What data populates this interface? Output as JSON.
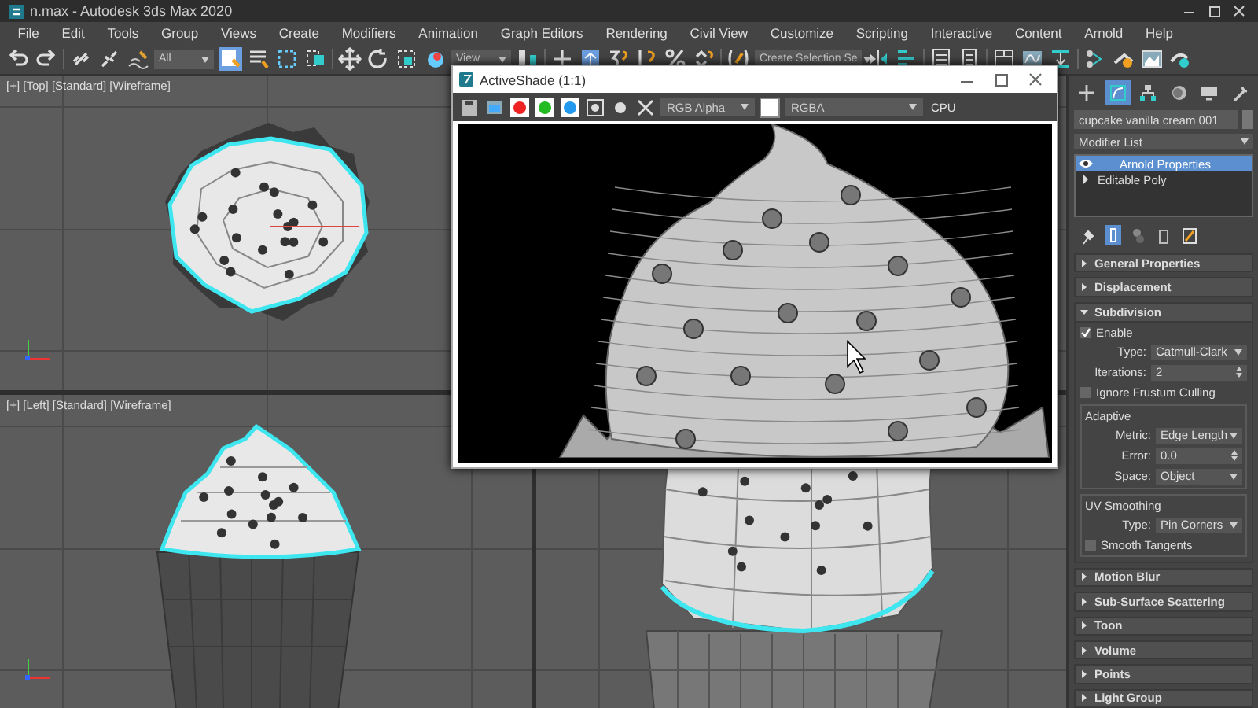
{
  "window": {
    "title": "n.max - Autodesk 3ds Max 2020"
  },
  "menu": [
    "File",
    "Edit",
    "Tools",
    "Group",
    "Views",
    "Create",
    "Modifiers",
    "Animation",
    "Graph Editors",
    "Rendering",
    "Civil View",
    "Customize",
    "Scripting",
    "Interactive",
    "Content",
    "Arnold",
    "Help"
  ],
  "toolbar": {
    "selection_filter": "All",
    "reference_coordinates": "View",
    "selection_set": "Create Selection Se"
  },
  "viewports": [
    {
      "label": "[+] [Top] [Standard] [Wireframe]",
      "kind": "top"
    },
    {
      "kind": "hidden"
    },
    {
      "label": "[+] [Left] [Standard] [Wireframe]",
      "kind": "left"
    },
    {
      "kind": "perspective"
    }
  ],
  "activeshade": {
    "title": "ActiveShade (1:1)",
    "channel": "RGB Alpha",
    "display": "RGBA",
    "renderer": "CPU"
  },
  "command_panel": {
    "tabs": [
      {
        "kind": "create",
        "selected": false
      },
      {
        "kind": "modify",
        "selected": true
      },
      {
        "kind": "hierarchy",
        "selected": false
      },
      {
        "kind": "motion",
        "selected": false
      },
      {
        "kind": "display",
        "selected": false
      },
      {
        "kind": "utilities",
        "selected": false
      }
    ],
    "object_name": "cupcake vanilla cream 001",
    "modifier_list": "Modifier List",
    "stack": [
      {
        "label": "Arnold Properties",
        "kind": "modifier",
        "selected": true
      },
      {
        "label": "Editable Poly",
        "kind": "base",
        "selected": false
      }
    ],
    "rollouts": [
      {
        "title": "General Properties",
        "expanded": false
      },
      {
        "title": "Displacement",
        "expanded": false
      },
      {
        "title": "Subdivision",
        "expanded": true,
        "body": [
          {
            "kind": "checkbox",
            "label": "Enable",
            "checked": true
          },
          {
            "kind": "dropdown",
            "label": "Type:",
            "value": "Catmull-Clark"
          },
          {
            "kind": "spinner",
            "label": "Iterations:",
            "value": "2"
          },
          {
            "kind": "checkbox",
            "label": "Ignore Frustum Culling",
            "checked": false
          },
          {
            "kind": "group",
            "title": "Adaptive",
            "items": [
              {
                "kind": "dropdown",
                "label": "Metric:",
                "value": "Edge Length"
              },
              {
                "kind": "spinner",
                "label": "Error:",
                "value": "0.0"
              },
              {
                "kind": "dropdown",
                "label": "Space:",
                "value": "Object"
              }
            ]
          },
          {
            "kind": "group",
            "title": "UV Smoothing",
            "items": [
              {
                "kind": "dropdown",
                "label": "Type:",
                "value": "Pin Corners"
              },
              {
                "kind": "checkbox",
                "label": "Smooth Tangents",
                "checked": false
              }
            ]
          }
        ]
      },
      {
        "title": "Motion Blur",
        "expanded": false
      },
      {
        "title": "Sub-Surface Scattering",
        "expanded": false
      },
      {
        "title": "Toon",
        "expanded": false
      },
      {
        "title": "Volume",
        "expanded": false
      },
      {
        "title": "Points",
        "expanded": false
      },
      {
        "title": "Light Group",
        "expanded": false
      }
    ]
  }
}
